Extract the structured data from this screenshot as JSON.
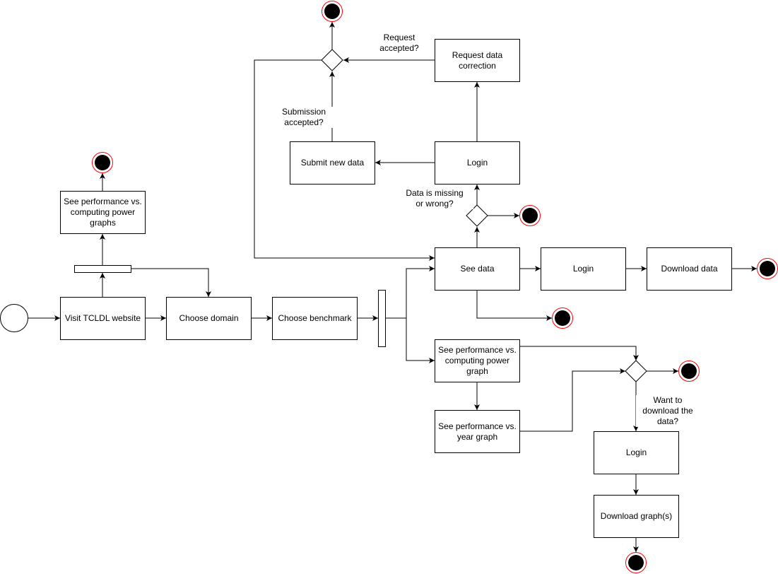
{
  "diagram": {
    "type": "UML activity diagram",
    "colors": {
      "stroke": "#000000",
      "final_node_ring": "#ff0000",
      "fill": "#ffffff"
    },
    "actions": {
      "visit_website": "Visit TCLDL website",
      "choose_domain": "Choose domain",
      "choose_benchmark": "Choose benchmark",
      "see_perf_graphs_top": "See performance vs.\ncomputing power\ngraphs",
      "see_data": "See data",
      "login_data": "Login",
      "download_data": "Download data",
      "login_correction": "Login",
      "submit_new_data": "Submit new data",
      "request_correction": "Request data\ncorrection",
      "see_perf_compute_graph": "See performance vs.\ncomputing power\ngraph",
      "see_perf_year_graph": "See performance vs.\nyear graph",
      "login_graph": "Login",
      "download_graphs": "Download graph(s)"
    },
    "guards": {
      "request_accepted": "Request\naccepted?",
      "submission_accepted": "Submission\naccepted?",
      "data_missing": "Data is missing\nor wrong?",
      "want_download": "Want to\ndownload the\ndata?"
    },
    "edges": [
      [
        "start",
        "visit_website"
      ],
      [
        "visit_website",
        "fork_top"
      ],
      [
        "fork_top",
        "see_perf_graphs_top"
      ],
      [
        "fork_top",
        "choose_domain"
      ],
      [
        "see_perf_graphs_top",
        "final_1"
      ],
      [
        "visit_website",
        "choose_domain"
      ],
      [
        "choose_domain",
        "choose_benchmark"
      ],
      [
        "choose_benchmark",
        "fork_main"
      ],
      [
        "fork_main",
        "see_data"
      ],
      [
        "fork_main",
        "see_perf_compute_graph"
      ],
      [
        "see_data",
        "login_data"
      ],
      [
        "login_data",
        "download_data"
      ],
      [
        "download_data",
        "final_2"
      ],
      [
        "see_data",
        "final_3"
      ],
      [
        "see_data",
        "decision_missing"
      ],
      [
        "decision_missing",
        "final_4"
      ],
      [
        "decision_missing",
        "login_correction"
      ],
      [
        "login_correction",
        "submit_new_data"
      ],
      [
        "login_correction",
        "request_correction"
      ],
      [
        "submit_new_data",
        "decision_accepted"
      ],
      [
        "request_correction",
        "decision_accepted"
      ],
      [
        "decision_accepted",
        "final_5"
      ],
      [
        "decision_accepted",
        "see_data"
      ],
      [
        "see_perf_compute_graph",
        "see_perf_year_graph"
      ],
      [
        "see_perf_compute_graph",
        "decision_download"
      ],
      [
        "see_perf_year_graph",
        "decision_download"
      ],
      [
        "decision_download",
        "final_6"
      ],
      [
        "decision_download",
        "login_graph"
      ],
      [
        "login_graph",
        "download_graphs"
      ],
      [
        "download_graphs",
        "final_7"
      ]
    ]
  }
}
